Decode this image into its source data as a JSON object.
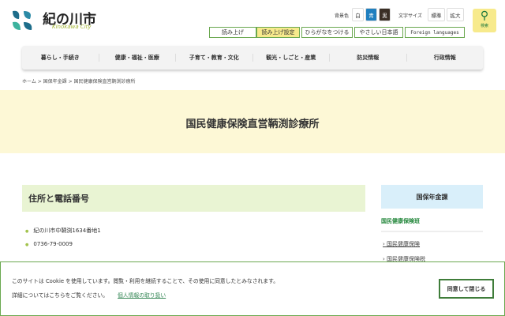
{
  "header": {
    "logo_text": "紀の川市",
    "logo_sub": "Kinokawa City",
    "bg_label": "背景色",
    "bg_options": [
      "白",
      "青",
      "黒"
    ],
    "font_label": "文字サイズ",
    "font_options": [
      "標準",
      "拡大"
    ],
    "search_label": "検索",
    "tools": [
      "読み上げ",
      "読み上げ設定",
      "ひらがなをつける",
      "やさしい日本語",
      "Foreign languages"
    ]
  },
  "nav": [
    "暮らし・手続き",
    "健康・福祉・医療",
    "子育て・教育・文化",
    "観光・しごと・産業",
    "防災情報",
    "行政情報"
  ],
  "breadcrumb": "ホーム > 国保年金課 > 国民健康保険直営鞆渕診療所",
  "page_title": "国民健康保険直営鞆渕診療所",
  "section": {
    "heading": "住所と電話番号",
    "items": [
      "紀の川市中鞆渕1634番地1",
      "0736-79-0009"
    ]
  },
  "sidebar": {
    "heading": "国保年金課",
    "subheading": "国民健康保険班",
    "links": [
      "国民健康保険",
      "国民健康保険税"
    ]
  },
  "cookie": {
    "line1": "このサイトは Cookie を使用しています。閲覧・利用を継続することで、その使用に同意したとみなされます。",
    "line2": "詳細についてはこちらをご覧ください。",
    "link": "個人情報の取り扱い",
    "button": "同意して閉じる"
  }
}
